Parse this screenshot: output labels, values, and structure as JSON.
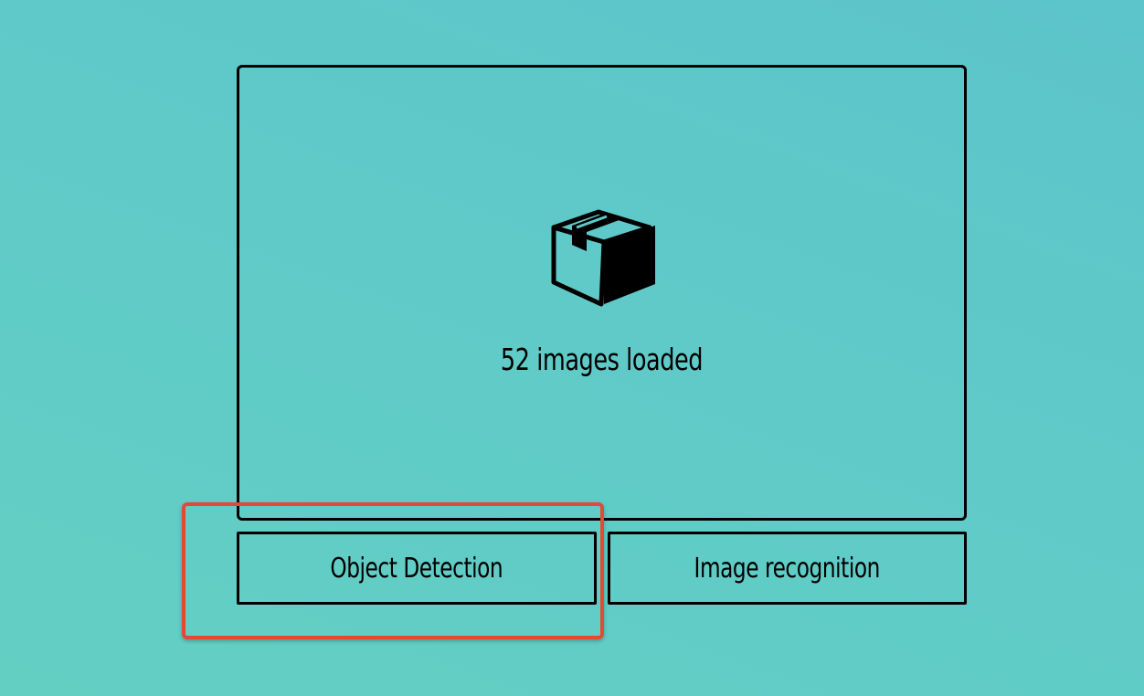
{
  "dropzone": {
    "icon": "package-box-icon",
    "status_text": "52 images loaded"
  },
  "actions": {
    "object_detection_label": "Object Detection",
    "image_recognition_label": "Image recognition"
  },
  "colors": {
    "highlight": "#e24a33",
    "border": "#000000",
    "background_start": "#5cc4cb",
    "background_end": "#63cfc3"
  }
}
